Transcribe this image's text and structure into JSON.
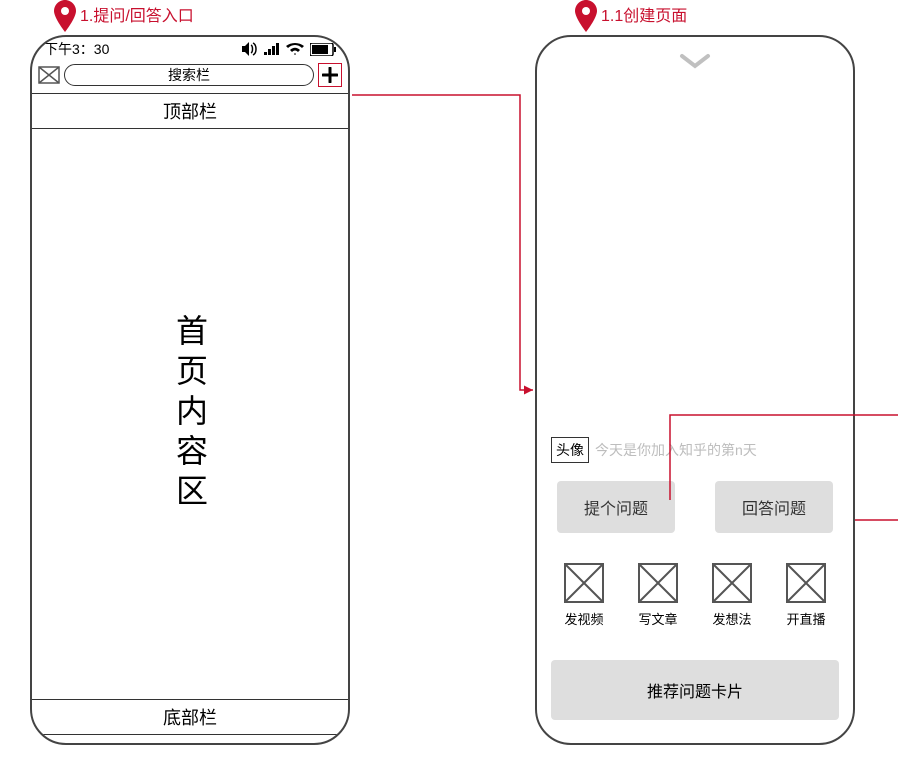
{
  "annotations": {
    "pin1": "1.提问/回答入口",
    "pin2": "1.1创建页面"
  },
  "leftPhone": {
    "status_time": "下午3：30",
    "search_placeholder": "搜索栏",
    "top_bar": "顶部栏",
    "content": "首页内容区",
    "bottom_bar": "底部栏"
  },
  "rightPhone": {
    "avatar_label": "头像",
    "avatar_hint": "今天是你加入知乎的第n天",
    "ask_btn": "提个问题",
    "answer_btn": "回答问题",
    "actions": {
      "video": "发视频",
      "article": "写文章",
      "idea": "发想法",
      "live": "开直播"
    },
    "reco_card": "推荐问题卡片"
  }
}
